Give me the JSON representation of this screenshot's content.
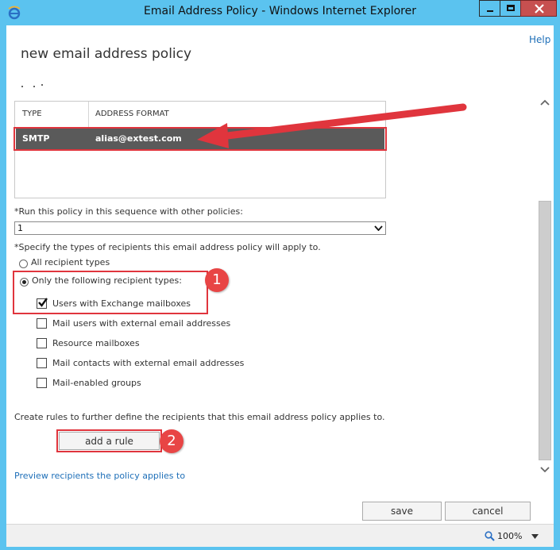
{
  "window": {
    "title": "Email Address Policy - Windows Internet Explorer"
  },
  "help_label": "Help",
  "page_title": "new email address policy",
  "table": {
    "headers": [
      "TYPE",
      "ADDRESS FORMAT"
    ],
    "rows": [
      {
        "type": "SMTP",
        "address_format": "alias@extest.com"
      }
    ]
  },
  "sequence": {
    "label": "*Run this policy in this sequence with other policies:",
    "value": "1"
  },
  "recipients": {
    "label": "*Specify the types of recipients this email address policy will apply to.",
    "all_label": "All recipient types",
    "only_label": "Only the following recipient types:",
    "options": [
      {
        "label": "Users with Exchange mailboxes",
        "checked": true
      },
      {
        "label": "Mail users with external email addresses",
        "checked": false
      },
      {
        "label": "Resource mailboxes",
        "checked": false
      },
      {
        "label": "Mail contacts with external email addresses",
        "checked": false
      },
      {
        "label": "Mail-enabled groups",
        "checked": false
      }
    ]
  },
  "rules": {
    "label": "Create rules to further define the recipients that this email address policy applies to.",
    "add_rule_label": "add a rule"
  },
  "preview_link": "Preview recipients the policy applies to",
  "buttons": {
    "save": "save",
    "cancel": "cancel"
  },
  "status": {
    "zoom": "100%"
  },
  "annotations": [
    "1",
    "2"
  ],
  "colors": {
    "accent": "#1ba1e2",
    "highlight": "#e0353d",
    "link": "#1e6fb8",
    "selected_row": "#5a5a5a"
  }
}
